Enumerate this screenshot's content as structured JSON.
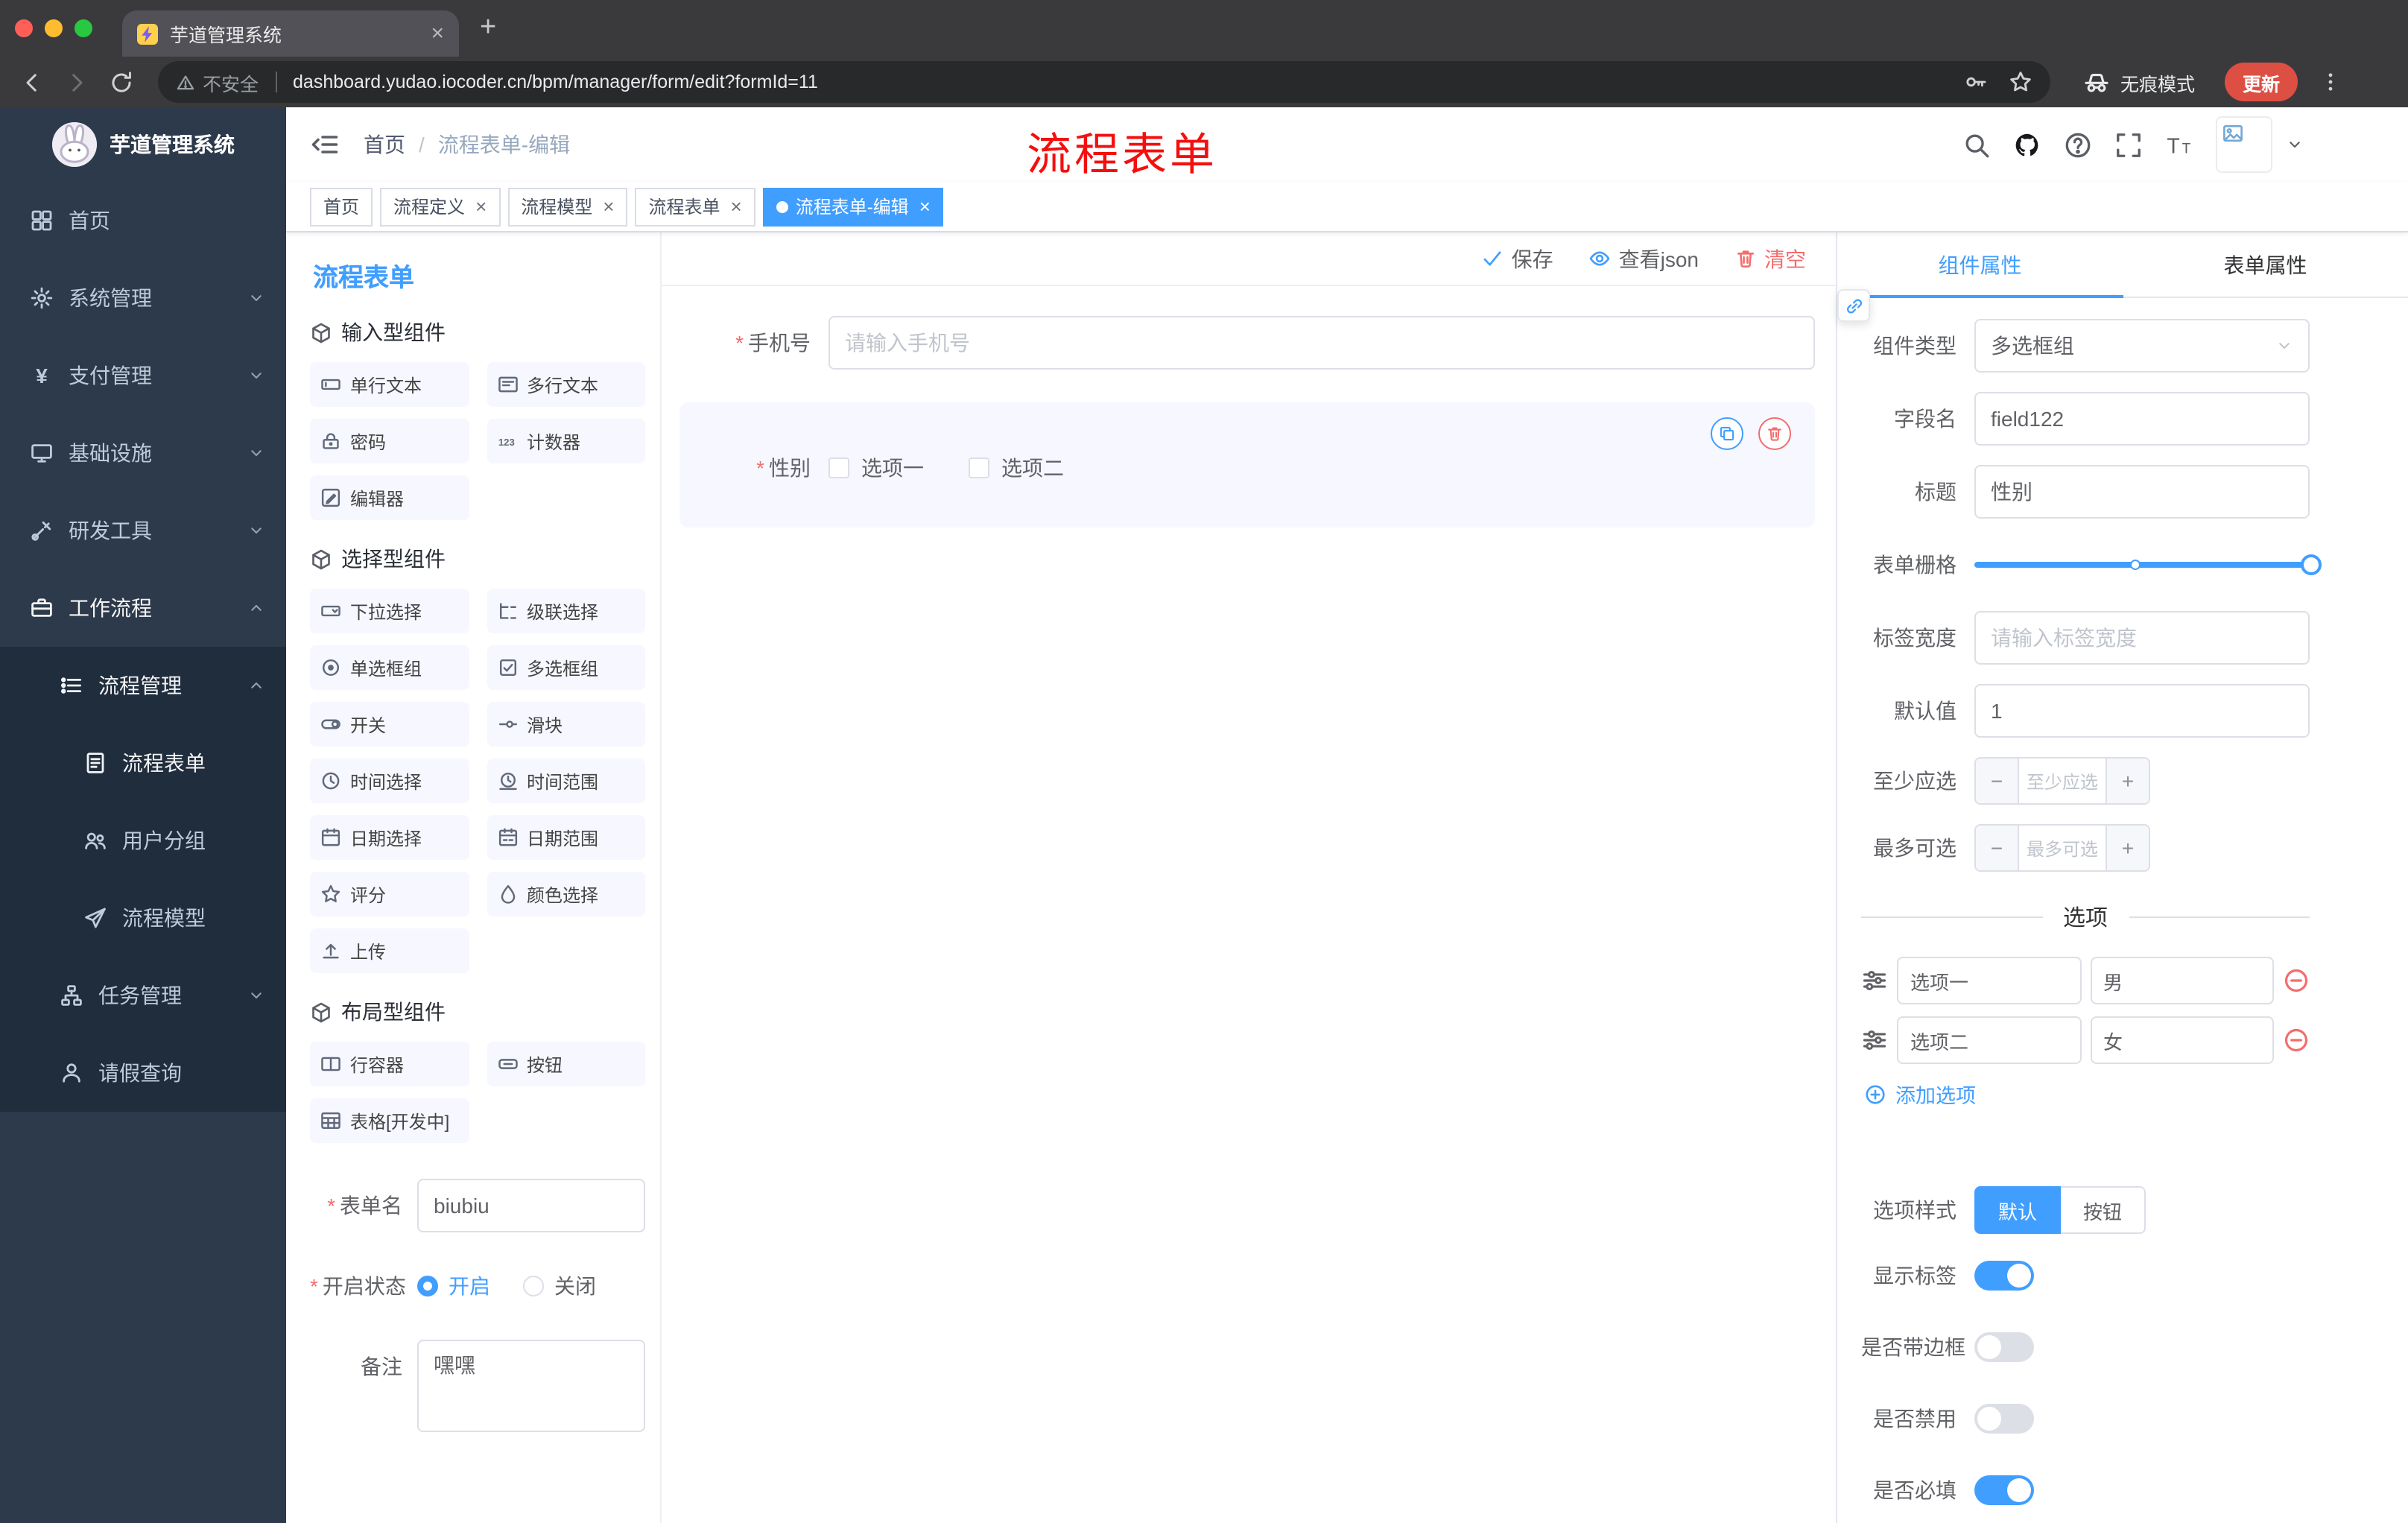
{
  "colors": {
    "accent": "#409eff",
    "danger": "#f56c6c",
    "annotation": "#f40f0f",
    "sidebar_bg": "#2d3a4b",
    "submenu_bg": "#1f2d3d",
    "update_pill": "#dd4f43"
  },
  "glyphs": {
    "close": "×",
    "plus": "+",
    "yen": "¥",
    "breadcrumb_sep": "/",
    "required_mark": "*",
    "minus": "−",
    "plus_sign": "+"
  },
  "browser": {
    "tab_title": "芋道管理系统",
    "security_label": "不安全",
    "url": "dashboard.yudao.iocoder.cn/bpm/manager/form/edit?formId=11",
    "incognito_label": "无痕模式",
    "update_label": "更新"
  },
  "sidebar": {
    "logo_title": "芋道管理系统",
    "items": [
      {
        "label": "首页",
        "icon": "dashboard"
      },
      {
        "label": "系统管理",
        "icon": "gear"
      },
      {
        "label": "支付管理",
        "icon": "yen"
      },
      {
        "label": "基础设施",
        "icon": "monitor"
      },
      {
        "label": "研发工具",
        "icon": "tools"
      },
      {
        "label": "工作流程",
        "icon": "workflow"
      },
      {
        "label": "流程管理",
        "icon": "process"
      },
      {
        "label": "流程表单",
        "icon": "form"
      },
      {
        "label": "用户分组",
        "icon": "user-group"
      },
      {
        "label": "流程模型",
        "icon": "paper-plane"
      },
      {
        "label": "任务管理",
        "icon": "task"
      },
      {
        "label": "请假查询",
        "icon": "person"
      }
    ]
  },
  "header": {
    "breadcrumb_home": "首页",
    "breadcrumb_current": "流程表单-编辑",
    "annotation": "流程表单"
  },
  "tags": [
    {
      "label": "首页"
    },
    {
      "label": "流程定义"
    },
    {
      "label": "流程模型"
    },
    {
      "label": "流程表单"
    },
    {
      "label": "流程表单-编辑"
    }
  ],
  "palette": {
    "title": "流程表单",
    "groups": [
      {
        "title": "输入型组件",
        "items": [
          {
            "label": "单行文本",
            "icon": "input"
          },
          {
            "label": "多行文本",
            "icon": "textarea"
          },
          {
            "label": "密码",
            "icon": "password"
          },
          {
            "label": "计数器",
            "icon": "counter"
          },
          {
            "label": "编辑器",
            "icon": "editor"
          }
        ]
      },
      {
        "title": "选择型组件",
        "items": [
          {
            "label": "下拉选择",
            "icon": "select"
          },
          {
            "label": "级联选择",
            "icon": "cascader"
          },
          {
            "label": "单选框组",
            "icon": "radio"
          },
          {
            "label": "多选框组",
            "icon": "checkbox"
          },
          {
            "label": "开关",
            "icon": "switch"
          },
          {
            "label": "滑块",
            "icon": "slider"
          },
          {
            "label": "时间选择",
            "icon": "time"
          },
          {
            "label": "时间范围",
            "icon": "time-range"
          },
          {
            "label": "日期选择",
            "icon": "date"
          },
          {
            "label": "日期范围",
            "icon": "date-range"
          },
          {
            "label": "评分",
            "icon": "rate"
          },
          {
            "label": "颜色选择",
            "icon": "color"
          },
          {
            "label": "上传",
            "icon": "upload"
          }
        ]
      },
      {
        "title": "布局型组件",
        "items": [
          {
            "label": "行容器",
            "icon": "row"
          },
          {
            "label": "按钮",
            "icon": "button"
          },
          {
            "label": "表格[开发中]",
            "icon": "table"
          }
        ]
      }
    ],
    "form": {
      "name_label": "表单名",
      "name_value": "biubiu",
      "status_label": "开启状态",
      "status_on": "开启",
      "status_off": "关闭",
      "remark_label": "备注",
      "remark_value": "嘿嘿"
    }
  },
  "canvas": {
    "save_label": "保存",
    "view_json_label": "查看json",
    "clear_label": "清空",
    "phone_label": "手机号",
    "phone_placeholder": "请输入手机号",
    "gender_label": "性别",
    "gender_options": [
      {
        "label": "选项一"
      },
      {
        "label": "选项二"
      }
    ]
  },
  "inspector": {
    "tab_component": "组件属性",
    "tab_form": "表单属性",
    "component_type_label": "组件类型",
    "component_type_value": "多选框组",
    "field_name_label": "字段名",
    "field_name_value": "field122",
    "title_label": "标题",
    "title_value": "性别",
    "grid_label": "表单栅格",
    "label_width_label": "标签宽度",
    "label_width_placeholder": "请输入标签宽度",
    "default_label": "默认值",
    "default_value": "1",
    "min_label": "至少应选",
    "min_placeholder": "至少应选",
    "max_label": "最多可选",
    "max_placeholder": "最多可选",
    "options_title": "选项",
    "options": [
      {
        "label": "选项一",
        "value": "男"
      },
      {
        "label": "选项二",
        "value": "女"
      }
    ],
    "add_option_label": "添加选项",
    "option_style_label": "选项样式",
    "option_style_default": "默认",
    "option_style_button": "按钮",
    "switches": [
      {
        "label": "显示标签",
        "on": true
      },
      {
        "label": "是否带边框",
        "on": false
      },
      {
        "label": "是否禁用",
        "on": false
      },
      {
        "label": "是否必填",
        "on": true
      }
    ]
  }
}
